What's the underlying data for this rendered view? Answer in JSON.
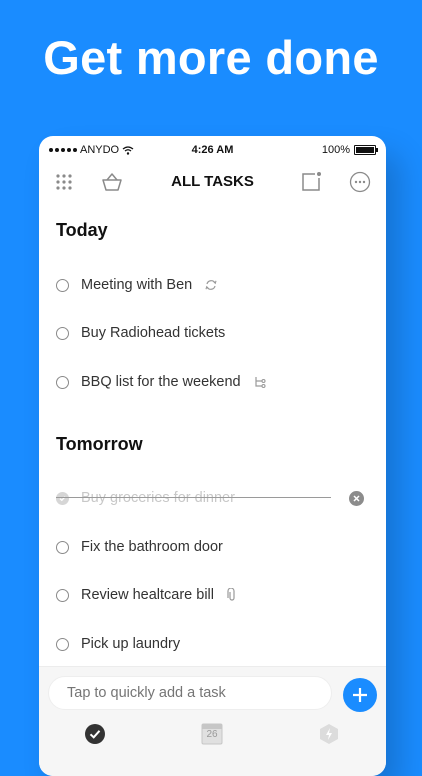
{
  "headline": "Get more done",
  "status_bar": {
    "carrier": "ANYDO",
    "time": "4:26 AM",
    "battery": "100%"
  },
  "nav": {
    "title": "ALL TASKS",
    "icons": [
      "grid-icon",
      "basket-icon",
      "note-icon",
      "more-icon"
    ]
  },
  "sections": [
    {
      "title": "Today",
      "tasks": [
        {
          "label": "Meeting with Ben",
          "icon": "recurring-icon",
          "done": false
        },
        {
          "label": "Buy Radiohead tickets",
          "icon": "",
          "done": false
        },
        {
          "label": "BBQ list for the weekend",
          "icon": "subtasks-icon",
          "done": false
        }
      ]
    },
    {
      "title": "Tomorrow",
      "tasks": [
        {
          "label": "Buy groceries for dinner",
          "icon": "",
          "done": true
        },
        {
          "label": "Fix the bathroom door",
          "icon": "",
          "done": false
        },
        {
          "label": "Review healtcare bill",
          "icon": "attachment-icon",
          "done": false
        },
        {
          "label": "Pick up laundry",
          "icon": "",
          "done": false
        }
      ]
    }
  ],
  "quick_add": {
    "placeholder": "Tap to quickly add a task"
  },
  "tabbar": {
    "calendar_day": "26",
    "tabs": [
      "tasks-tab-icon",
      "calendar-tab-icon",
      "moment-tab-icon"
    ]
  },
  "colors": {
    "accent": "#1a8cff",
    "text": "#333333"
  }
}
